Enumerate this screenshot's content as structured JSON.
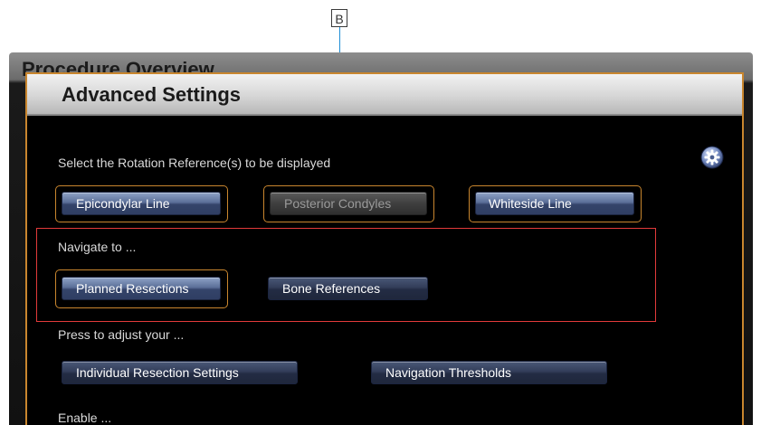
{
  "callout": {
    "label": "B"
  },
  "background": {
    "title": "Procedure Overview"
  },
  "dialog": {
    "title": "Advanced Settings",
    "rotation": {
      "label": "Select the Rotation Reference(s) to be displayed",
      "buttons": [
        {
          "label": "Epicondylar Line",
          "state": "selected"
        },
        {
          "label": "Posterior Condyles",
          "state": "disabled"
        },
        {
          "label": "Whiteside Line",
          "state": "selected"
        }
      ]
    },
    "navigate": {
      "label": "Navigate to ...",
      "buttons": [
        {
          "label": "Planned Resections",
          "state": "selected"
        },
        {
          "label": "Bone References",
          "state": "normal"
        }
      ]
    },
    "adjust": {
      "label": "Press to adjust your ...",
      "buttons": [
        {
          "label": "Individual Resection Settings"
        },
        {
          "label": "Navigation Thresholds"
        }
      ]
    },
    "enable": {
      "label": "Enable ..."
    }
  },
  "colors": {
    "selection_border": "#c9862e",
    "highlight": "#e23a3a",
    "callout_line": "#1f8fd6",
    "button_blue": "#4b5f8a"
  },
  "icons": {
    "settings": "gear-icon"
  }
}
